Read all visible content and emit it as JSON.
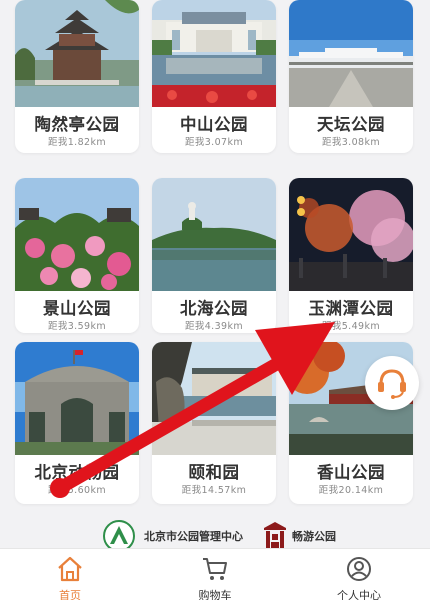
{
  "parks": [
    {
      "name": "陶然亭公园",
      "distance": "距我1.82km"
    },
    {
      "name": "中山公园",
      "distance": "距我3.07km"
    },
    {
      "name": "天坛公园",
      "distance": "距我3.08km"
    },
    {
      "name": "景山公园",
      "distance": "距我3.59km"
    },
    {
      "name": "北海公园",
      "distance": "距我4.39km"
    },
    {
      "name": "玉渊潭公园",
      "distance": "距我5.49km"
    },
    {
      "name": "北京动物园",
      "distance": "距我5.60km"
    },
    {
      "name": "颐和园",
      "distance": "距我14.57km"
    },
    {
      "name": "香山公园",
      "distance": "距我20.14km"
    }
  ],
  "partners": {
    "left_label": "北京市公园管理中心",
    "right_label": "畅游公园"
  },
  "tabs": {
    "home": "首页",
    "cart": "购物车",
    "profile": "个人中心"
  },
  "icons": {
    "customer_service": "headset-icon",
    "home": "home-icon",
    "cart": "cart-icon",
    "profile": "user-icon"
  },
  "colors": {
    "accent": "#e8803a",
    "annotation_arrow": "#e0141c"
  }
}
